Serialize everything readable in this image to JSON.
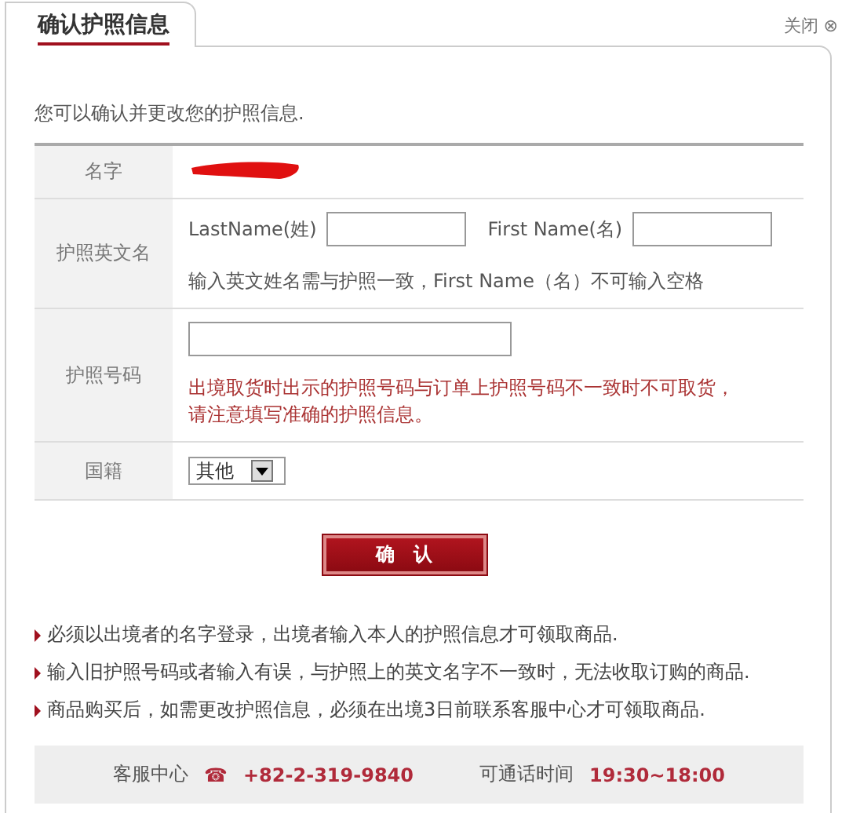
{
  "tab": {
    "title": "确认护照信息",
    "selected": true
  },
  "close": {
    "label": "关闭",
    "icon": "⊗"
  },
  "intro": "您可以确认并更改您的护照信息.",
  "form": {
    "rows": [
      {
        "kind": "redacted",
        "label": "名字"
      },
      {
        "kind": "english_name",
        "label": "护照英文名",
        "last_name_label": "LastName(姓)",
        "first_name_label": "First Name(名)",
        "hint": "输入英文姓名需与护照一致，First Name（名）不可输入空格"
      },
      {
        "kind": "passport",
        "label": "护照号码",
        "warning": [
          "出境取货时出示的护照号码与订单上护照号码不一致时不可取货，",
          "请注意填写准确的护照信息。"
        ]
      },
      {
        "kind": "select",
        "label": "国籍",
        "value": "其他"
      }
    ]
  },
  "confirm_button": "确　认",
  "notes": [
    "必须以出境者的名字登录，出境者输入本人的护照信息才可领取商品.",
    "输入旧护照号码或者输入有误，与护照上的英文名字不一致时，无法收取订购的商品.",
    "商品购买后，如需更改护照信息，必须在出境3日前联系客服中心才可领取商品."
  ],
  "footer": {
    "service_label": "客服中心",
    "phone_icon": "☎",
    "phone": "+82-2-319-9840",
    "hours_label": "可通话时间",
    "hours": "19:30~18:00"
  }
}
